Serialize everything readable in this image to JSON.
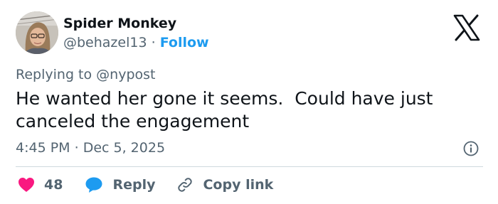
{
  "author": {
    "name": "Spider Monkey",
    "handle": "@behazel13",
    "separator": "·",
    "follow_label": "Follow"
  },
  "reply_context": {
    "prefix": "Replying to",
    "mention": "@nypost"
  },
  "tweet": {
    "text": "He wanted her gone it seems.  Could have just\ncanceled the engagement",
    "time": "4:45 PM",
    "separator": "·",
    "date": "Dec 5, 2025"
  },
  "actions": {
    "like_count": "48",
    "reply_label": "Reply",
    "copy_link_label": "Copy link"
  },
  "colors": {
    "like": "#f91880",
    "reply": "#1d9bf0",
    "link": "#1d9bf0",
    "secondary_text": "#536471"
  },
  "icons": {
    "brand": "x-logo-icon",
    "info": "info-icon",
    "like": "heart-icon",
    "reply": "speech-bubble-icon",
    "copy": "chain-link-icon"
  }
}
